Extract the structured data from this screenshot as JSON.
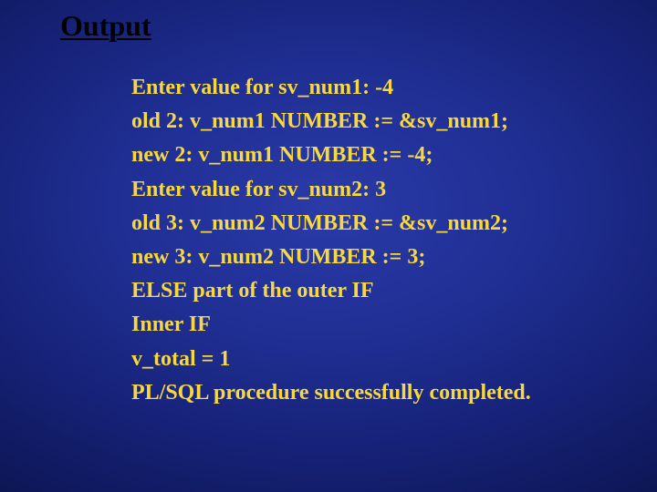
{
  "heading": "Output",
  "lines": [
    "Enter value for sv_num1: -4",
    "old 2: v_num1 NUMBER := &sv_num1;",
    "new 2: v_num1 NUMBER := -4;",
    "Enter value for sv_num2: 3",
    "old 3: v_num2 NUMBER := &sv_num2;",
    "new 3: v_num2 NUMBER := 3;",
    "ELSE part of the outer IF",
    "Inner IF",
    "v_total = 1",
    "PL/SQL procedure successfully completed."
  ]
}
